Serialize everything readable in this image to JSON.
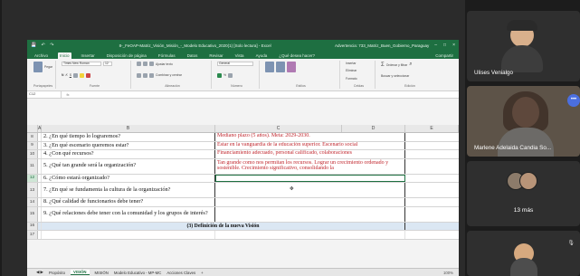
{
  "excel": {
    "title_left": "Autoguardado",
    "filename": "8-_FeOAP-Matriz_Visión_Misión_-_Modelo Educativo_2020(1) [Solo lectura] - Excel",
    "title_mid": "Advertencia: 733_Matriz_Buen_Gobierno_Paraguay",
    "winbtns": [
      "–",
      "□",
      "×"
    ],
    "tabs": [
      "Archivo",
      "Inicio",
      "Insertar",
      "Disposición de página",
      "Fórmulas",
      "Datos",
      "Revisar",
      "Vista",
      "Ayuda",
      "¿Qué desea hacer?"
    ],
    "active_tab": "Inicio",
    "share": "Compartir",
    "ribbon": {
      "clipboard_label": "Portapapeles",
      "paste": "Pegar",
      "font_name": "Times New Roman",
      "font_size": "12",
      "font_label": "Fuente",
      "align_label": "Alineación",
      "wrap": "Ajustar texto",
      "merge": "Combinar y centrar",
      "number_format": "General",
      "number_label": "Número",
      "styles_label": "Estilos",
      "cond_format": "Formato condicional",
      "table_format": "Dar formato como tabla",
      "cell_styles": "Estilos de celda",
      "cells_label": "Celdas",
      "insert": "Insertar",
      "delete": "Eliminar",
      "format": "Formato",
      "editing_label": "Edición",
      "sort": "Ordenar y filtrar",
      "find": "Buscar y seleccionar"
    },
    "namebox": "C12",
    "fx": "fx",
    "columns": [
      "A",
      "B",
      "C",
      "D",
      "E"
    ],
    "rows": [
      {
        "n": "8",
        "b": "2. ¿En qué tiempo lo lograremos?",
        "c": "Mediano plazo (5 años). Meta: 2029-2030.",
        "tall": false
      },
      {
        "n": "9",
        "b": "3. ¿En qué escenario queremos estar?",
        "c": "Estar en la vanguardia de la educación superior. Escenario social",
        "tall": false
      },
      {
        "n": "10",
        "b": "4. ¿Con qué recursos?",
        "c": "Financiamiento adecuado, personal calificado, colaboraciones",
        "tall": false
      },
      {
        "n": "11",
        "b": "5. ¿Qué tan grande será la organización?",
        "c": "Tan grande como nos permitan los recursos. Lograr un crecimiento ordenado y sostenible. Crecimiento significativo, consolidando la",
        "tall": true
      },
      {
        "n": "12",
        "b": "6. ¿Cómo estará organizado?",
        "c": "",
        "tall": false,
        "selected": true
      },
      {
        "n": "13",
        "b": "7. ¿En qué se fundamenta la cultura de la organización?",
        "c": "",
        "tall": true
      },
      {
        "n": "14",
        "b": "8. ¿Qué calidad de funcionarios debe tener?",
        "c": "",
        "tall": false
      },
      {
        "n": "15",
        "b": "9. ¿Qué relaciones debe tener con la comunidad y los grupos de interés?",
        "c": "",
        "tall": true
      }
    ],
    "heading_row": {
      "n": "16",
      "text": "(3) Definición de la nueva Visión"
    },
    "blank_row": "17",
    "sheet_tabs": [
      "Propósito",
      "VISIÓN",
      "MISIÓN",
      "Modelo Educativo - MP-MC",
      "Acciones Claves",
      "+"
    ],
    "active_sheet": "VISIÓN",
    "zoom": "100%"
  },
  "participants": [
    {
      "name": "Ulises Venialgo"
    },
    {
      "name": "Marlene Adelaida Candia So..."
    },
    {
      "name": "13 más"
    },
    {
      "name": ""
    }
  ],
  "colors": {
    "excel_green": "#1e6f41",
    "answer_red": "#c0262d",
    "heading_blue": "#dbe7f3",
    "more_button": "#4b6fe0"
  }
}
